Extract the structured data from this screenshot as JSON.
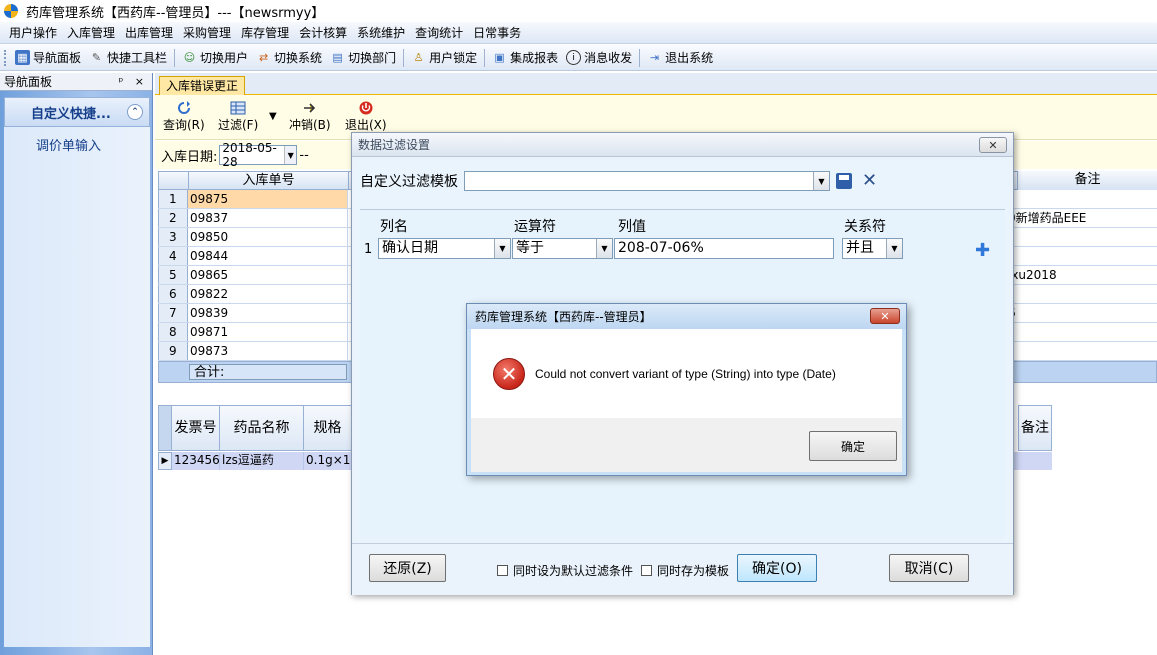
{
  "window": {
    "title": "药库管理系统【西药库--管理员】---【newsrmyy】"
  },
  "menu": [
    "用户操作",
    "入库管理",
    "出库管理",
    "采购管理",
    "库存管理",
    "会计核算",
    "系统维护",
    "查询统计",
    "日常事务"
  ],
  "toolbar": {
    "nav_panel": "导航面板",
    "quick_bar": "快捷工具栏",
    "switch_user": "切换用户",
    "switch_system": "切换系统",
    "switch_dept": "切换部门",
    "user_lock": "用户锁定",
    "report": "集成报表",
    "messages": "消息收发",
    "exit": "退出系统"
  },
  "nav": {
    "header": "导航面板",
    "controls": "ᵖ ×",
    "group": "自定义快捷...",
    "items": [
      "调价单输入"
    ]
  },
  "tab": {
    "label": "入库错误更正"
  },
  "content_toolbar": {
    "query": "查询(R)",
    "filter": "过滤(F)",
    "reverse": "冲销(B)",
    "exit": "退出(X)"
  },
  "filter": {
    "date_label": "入库日期:",
    "date_value": "2018-05-28",
    "dash": "--"
  },
  "grid": {
    "col_receipt": "入库单号",
    "col_note": "备注",
    "rows": [
      {
        "idx": "1",
        "value": "09875",
        "note": ""
      },
      {
        "idx": "2",
        "value": "09837",
        "note": "0新增药品EEE"
      },
      {
        "idx": "3",
        "value": "09850",
        "note": ""
      },
      {
        "idx": "4",
        "value": "09844",
        "note": ""
      },
      {
        "idx": "5",
        "value": "09865",
        "note": "ixu2018"
      },
      {
        "idx": "6",
        "value": "09822",
        "note": ""
      },
      {
        "idx": "7",
        "value": "09839",
        "note": "6"
      },
      {
        "idx": "8",
        "value": "09871",
        "note": ""
      },
      {
        "idx": "9",
        "value": "09873",
        "note": ""
      }
    ],
    "total_label": "合计:"
  },
  "detail_grid": {
    "cols": [
      "发票号",
      "药品名称",
      "规格"
    ],
    "note": "备注",
    "row": [
      "123456'",
      "lzs逗逼药",
      "0.1g×1"
    ]
  },
  "filter_dialog": {
    "title": "数据过滤设置",
    "close": "✕",
    "template_label": "自定义过滤模板",
    "col_headers": {
      "name": "列名",
      "op": "运算符",
      "value": "列值",
      "rel": "关系符"
    },
    "row": {
      "num": "1",
      "name": "确认日期",
      "op": "等于",
      "value": "208-07-06%",
      "rel": "并且"
    },
    "restore_btn": "还原(Z)",
    "chk_default": "同时设为默认过滤条件",
    "chk_template": "同时存为模板",
    "ok_btn": "确定(O)",
    "cancel_btn": "取消(C)"
  },
  "message_box": {
    "title": "药库管理系统【西药库--管理员】",
    "close": "✕",
    "icon": "error-icon",
    "text": "Could not convert variant of type (String) into type (Date)",
    "ok_btn": "确定"
  }
}
